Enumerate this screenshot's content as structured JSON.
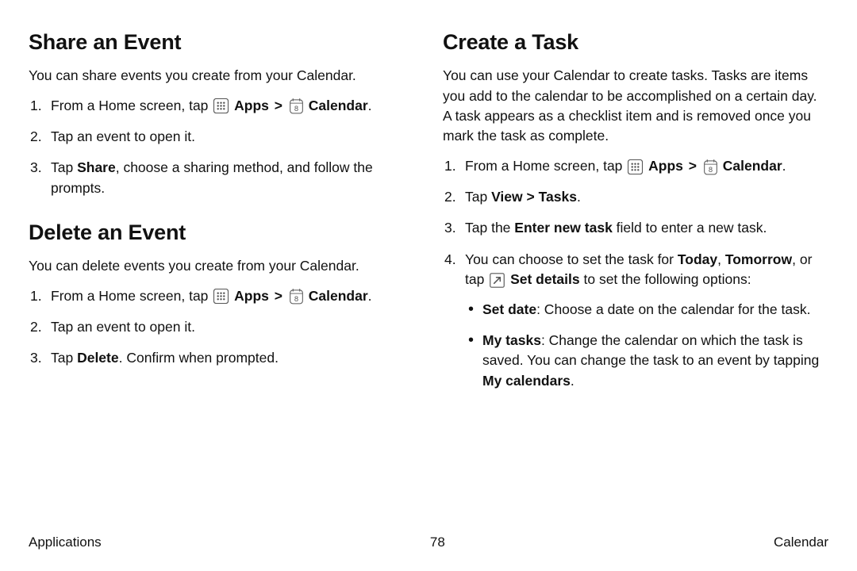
{
  "left": {
    "share": {
      "heading": "Share an Event",
      "intro": "You can share events you create from your Calendar.",
      "step1_pre": "From a Home screen, tap ",
      "apps_label": "Apps",
      "calendar_label": "Calendar",
      "step1_post": ".",
      "step2": "Tap an event to open it.",
      "step3_pre": "Tap ",
      "step3_share": "Share",
      "step3_post": ", choose a sharing method, and follow the prompts."
    },
    "delete": {
      "heading": "Delete an Event",
      "intro": "You can delete events you create from your Calendar.",
      "step1_pre": "From a Home screen, tap ",
      "apps_label": "Apps",
      "calendar_label": "Calendar",
      "step1_post": ".",
      "step2": "Tap an event to open it.",
      "step3_pre": "Tap ",
      "step3_delete": "Delete",
      "step3_post": ". Confirm when prompted."
    }
  },
  "right": {
    "task": {
      "heading": "Create a Task",
      "intro": "You can use your Calendar to create tasks. Tasks are items you add to the calendar to be accomplished on a certain day. A task appears as a checklist item and is removed once you mark the task as complete.",
      "step1_pre": "From a Home screen, tap ",
      "apps_label": "Apps",
      "calendar_label": "Calendar",
      "step1_post": ".",
      "step2_pre": "Tap ",
      "step2_view": "View",
      "step2_sep": " > ",
      "step2_tasks": "Tasks",
      "step2_post": ".",
      "step3_pre": "Tap the ",
      "step3_field": "Enter new task",
      "step3_post": " field to enter a new task.",
      "step4_pre": "You can choose to set the task for ",
      "step4_today": "Today",
      "step4_comma1": ", ",
      "step4_tomorrow": "Tomorrow",
      "step4_comma2": ", or tap ",
      "step4_setdetails": "Set details",
      "step4_post": " to set the following options:",
      "bullet1_label": "Set date",
      "bullet1_text": ": Choose a date on the calendar for the task.",
      "bullet2_label": "My tasks",
      "bullet2_text_pre": ": Change the calendar on which the task is saved. You can change the task to an event by tapping ",
      "bullet2_mycal": "My calendars",
      "bullet2_text_post": "."
    }
  },
  "footer": {
    "left": "Applications",
    "center": "78",
    "right": "Calendar"
  }
}
